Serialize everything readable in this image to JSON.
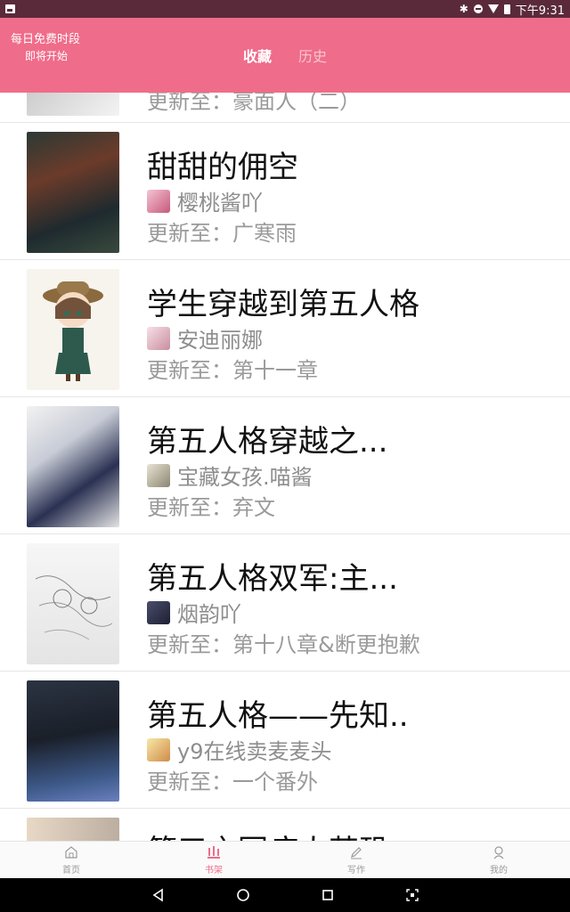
{
  "status_bar": {
    "time": "下午9:31",
    "icons": [
      "image-icon",
      "bluetooth-icon",
      "dnd-icon",
      "wifi-icon",
      "battery-icon"
    ]
  },
  "header": {
    "free_line1": "每日免费时段",
    "free_line2": "即将开始",
    "tabs": [
      {
        "label": "收藏",
        "active": true
      },
      {
        "label": "历史",
        "active": false
      }
    ],
    "accent": "#ef6c8a"
  },
  "books": [
    {
      "title": "",
      "author": "",
      "update": "更新至：豪面人（二）",
      "partial": "top"
    },
    {
      "title": "甜甜的佣空",
      "author": "樱桃酱吖",
      "update": "更新至：广寒雨"
    },
    {
      "title": "学生穿越到第五人格",
      "author": "安迪丽娜",
      "update": "更新至：第十一章"
    },
    {
      "title": "第五人格穿越之...",
      "author": "宝藏女孩.喵酱",
      "update": "更新至：弃文"
    },
    {
      "title": "第五人格双军:主...",
      "author": "烟韵吖",
      "update": "更新至：第十八章&断更抱歉"
    },
    {
      "title": "第五人格——先知..",
      "author": "y9在线卖麦麦头",
      "update": "更新至：一个番外"
    },
    {
      "title": "第五之园病人苦恐",
      "author": "",
      "update": "",
      "partial": "bottom"
    }
  ],
  "bottom_nav": [
    {
      "label": "首页",
      "icon": "home-icon",
      "active": false
    },
    {
      "label": "书架",
      "icon": "bookshelf-icon",
      "active": true
    },
    {
      "label": "写作",
      "icon": "pen-icon",
      "active": false
    },
    {
      "label": "我的",
      "icon": "profile-icon",
      "active": false
    }
  ],
  "system_nav": [
    "back-icon",
    "home-circle-icon",
    "recents-icon",
    "screenshot-icon"
  ]
}
